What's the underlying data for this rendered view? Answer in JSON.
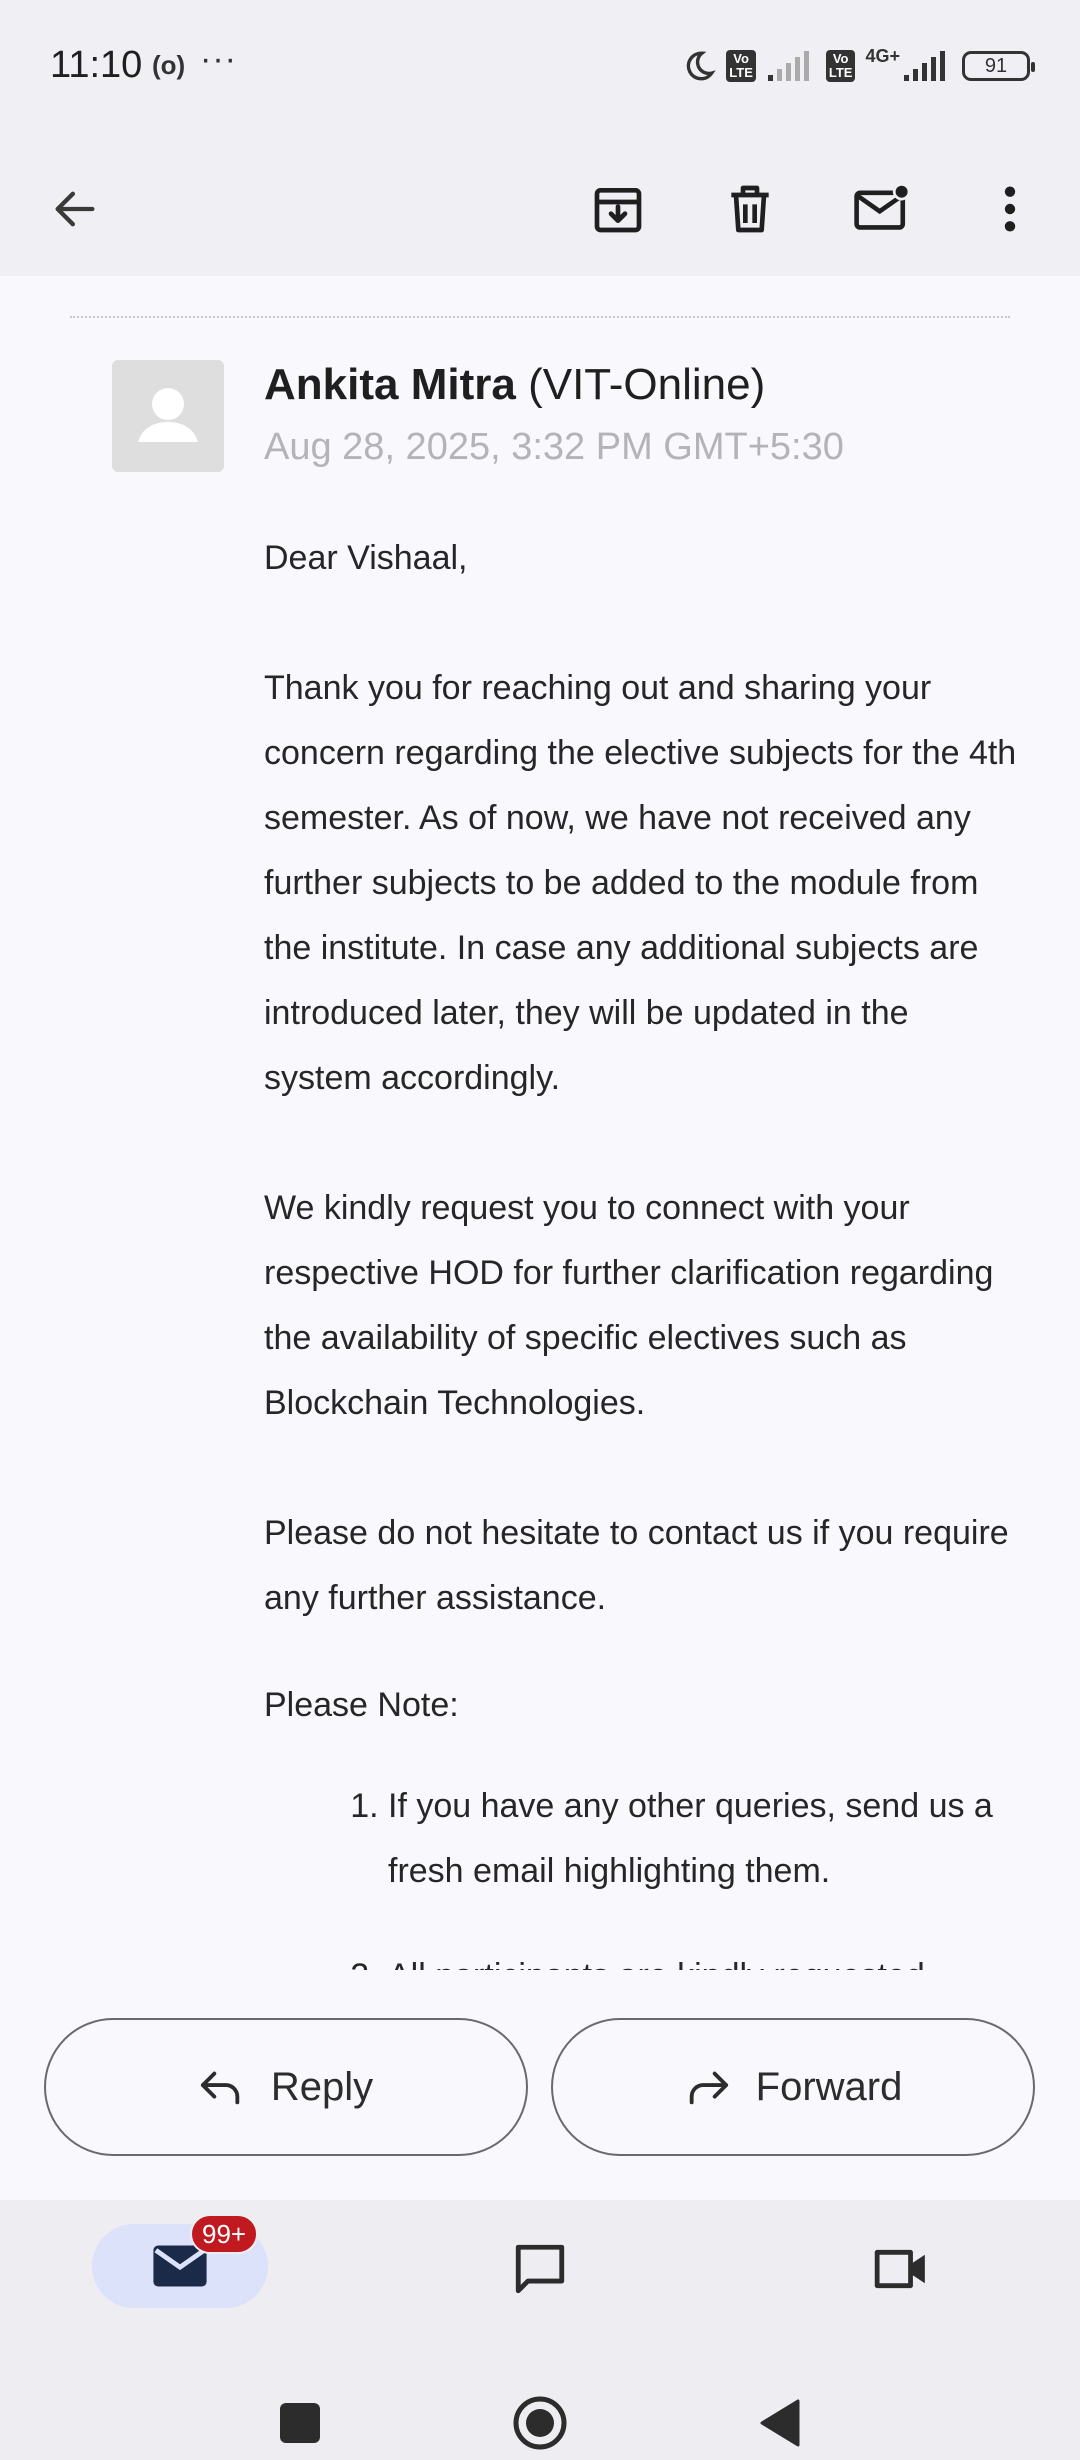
{
  "status_bar": {
    "time": "11:10",
    "hotspot_icon": "hotspot-icon",
    "more": "···",
    "volte_label": "Vo\nLTE",
    "network_label": "4G+",
    "battery": "91"
  },
  "toolbar": {
    "back_icon": "arrow-left-icon",
    "archive_icon": "archive-icon",
    "delete_icon": "trash-icon",
    "unread_icon": "mark-unread-icon",
    "more_icon": "more-vert-icon"
  },
  "email": {
    "sender_name": "Ankita Mitra",
    "sender_org": "(VIT-Online)",
    "date": "Aug 28, 2025, 3:32 PM GMT+5:30",
    "greeting": "Dear Vishaal,",
    "paragraph1": "Thank you for reaching out and sharing your concern regarding the elective subjects for the 4th semester. As of now, we have not received any further subjects to be added to the module from the institute. In case any additional subjects are introduced later, they will be updated in the system accordingly.",
    "paragraph2": "We kindly request you to connect with your respective HOD for further clarification regarding the availability of specific electives such as Blockchain Technologies.",
    "paragraph3": "Please do not hesitate to contact us if you require any further assistance.",
    "note_heading": "Please Note:",
    "notes": [
      "If you have any other queries, send us a fresh email highlighting them.",
      "All participants are kindly requested"
    ]
  },
  "actions": {
    "reply_label": "Reply",
    "forward_label": "Forward"
  },
  "bottom_nav": {
    "mail_badge": "99+",
    "mail_icon": "mail-icon",
    "chat_icon": "chat-icon",
    "meet_icon": "video-icon"
  },
  "colors": {
    "accent_pill": "#dce2fa",
    "badge": "#c0191f",
    "date_text": "#b3b3b8"
  }
}
